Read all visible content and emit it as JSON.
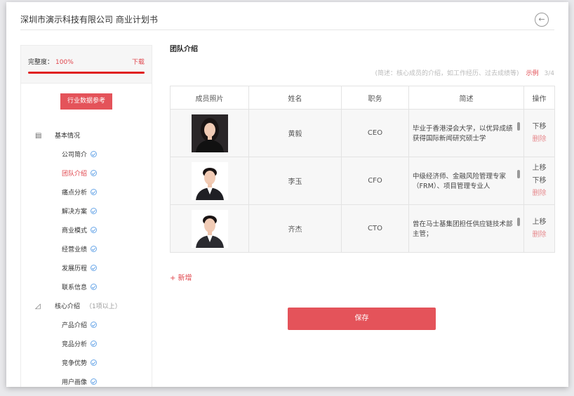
{
  "header": {
    "title": "深圳市演示科技有限公司  商业计划书",
    "back_icon": "arrow-left-circle-icon"
  },
  "sidebar": {
    "progress_label": "完整度：",
    "progress_value": "100%",
    "progress_fraction": 1.0,
    "download_label": "下载",
    "reference_button": "行业数据参考",
    "sections": [
      {
        "label": "基本情况",
        "icon": "document-icon",
        "sub": "",
        "items": [
          {
            "label": "公司简介",
            "active": false
          },
          {
            "label": "团队介绍",
            "active": true
          },
          {
            "label": "痛点分析",
            "active": false
          },
          {
            "label": "解决方案",
            "active": false
          },
          {
            "label": "商业模式",
            "active": false
          },
          {
            "label": "经营业绩",
            "active": false
          },
          {
            "label": "发展历程",
            "active": false
          },
          {
            "label": "联系信息",
            "active": false
          }
        ]
      },
      {
        "label": "核心介绍",
        "icon": "chart-icon",
        "sub": "（1项以上）",
        "items": [
          {
            "label": "产品介绍",
            "active": false
          },
          {
            "label": "竞品分析",
            "active": false
          },
          {
            "label": "竞争优势",
            "active": false
          },
          {
            "label": "用户画像",
            "active": false
          }
        ]
      }
    ]
  },
  "main": {
    "heading": "团队介绍",
    "hint": "(简述：核心成员的介绍，如工作经历、过去成绩等)",
    "example_label": "示例",
    "page": "3/4",
    "columns": [
      "成员照片",
      "姓名",
      "职务",
      "简述",
      "操作"
    ],
    "rows": [
      {
        "name": "黄毅",
        "role": "CEO",
        "desc": "毕业于香港浸会大学，以优异成绩获得国际新闻研究硕士学",
        "ops": [
          "下移",
          "删除"
        ]
      },
      {
        "name": "李玉",
        "role": "CFO",
        "desc": "中级经济师、金融风险管理专家（FRM）、项目管理专业人",
        "ops": [
          "上移",
          "下移",
          "删除"
        ]
      },
      {
        "name": "齐杰",
        "role": "CTO",
        "desc": "曾在马士基集团担任供应链技术部主管；",
        "ops": [
          "上移",
          "删除"
        ]
      }
    ],
    "add_label": "+ 新增",
    "save_label": "保存"
  }
}
